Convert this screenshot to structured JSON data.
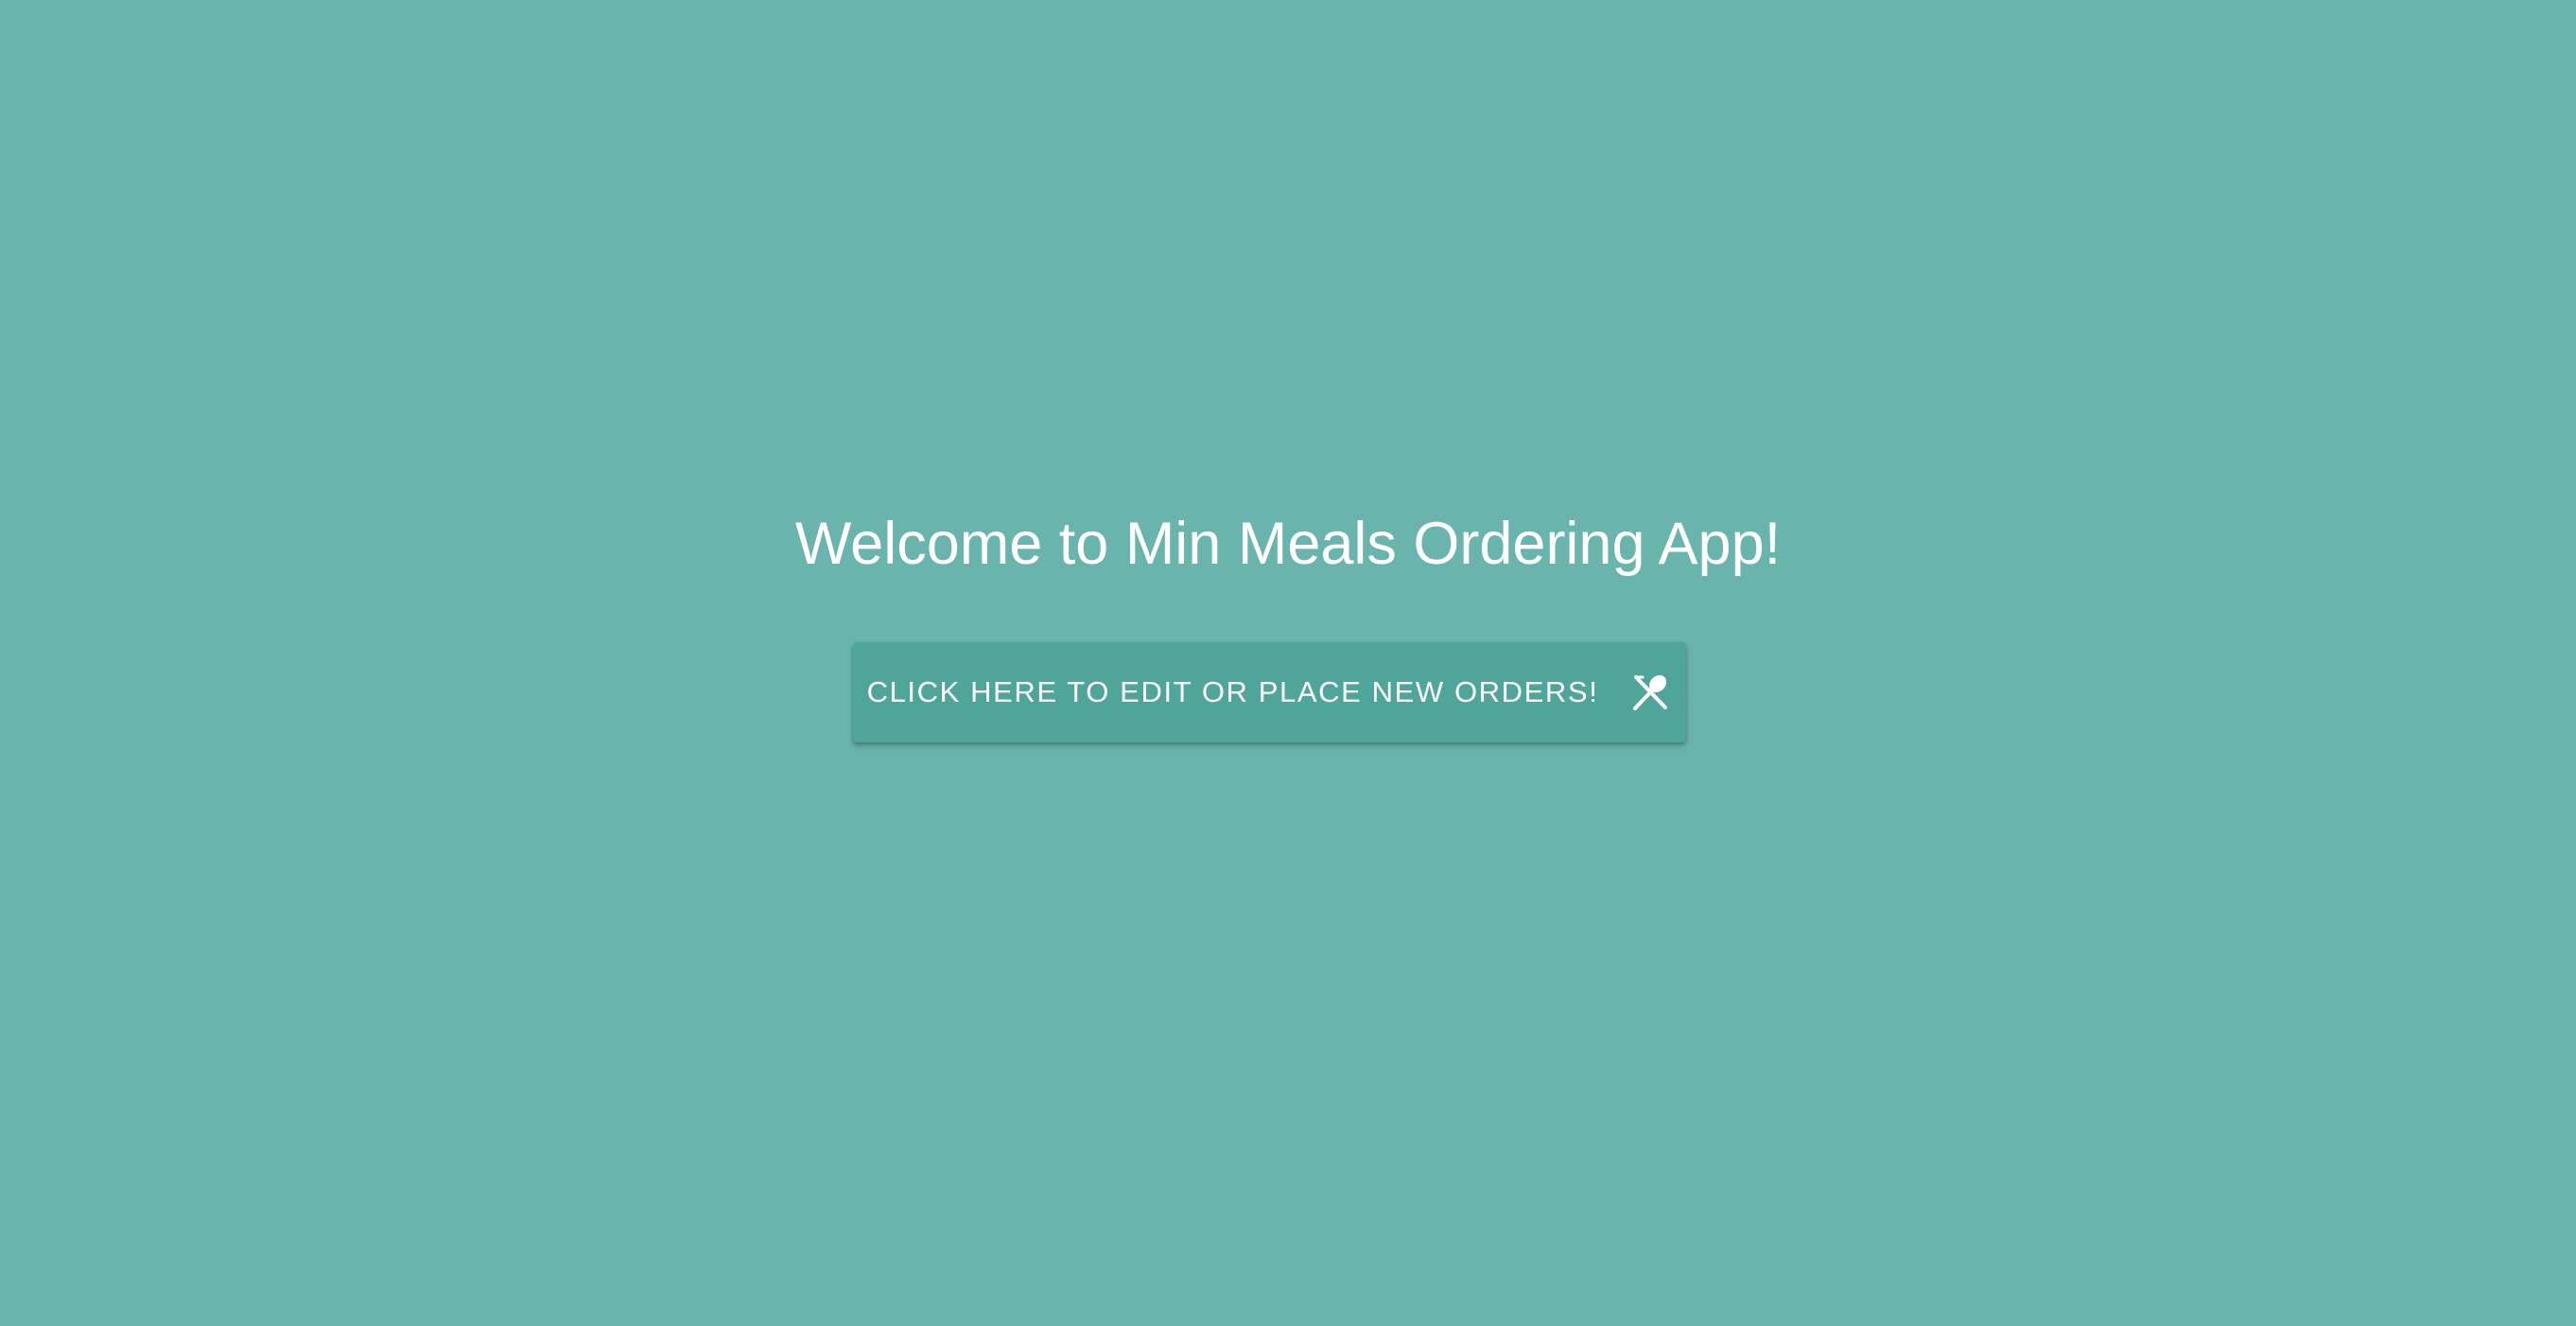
{
  "page": {
    "welcome_title": "Welcome to Min Meals Ordering App!",
    "cta_label": "CLICK HERE TO EDIT OR PLACE NEW ORDERS!",
    "cta_icon": "utensils-icon"
  },
  "colors": {
    "background": "#69b5ad",
    "button": "#50a59a",
    "text": "#ffffff"
  }
}
